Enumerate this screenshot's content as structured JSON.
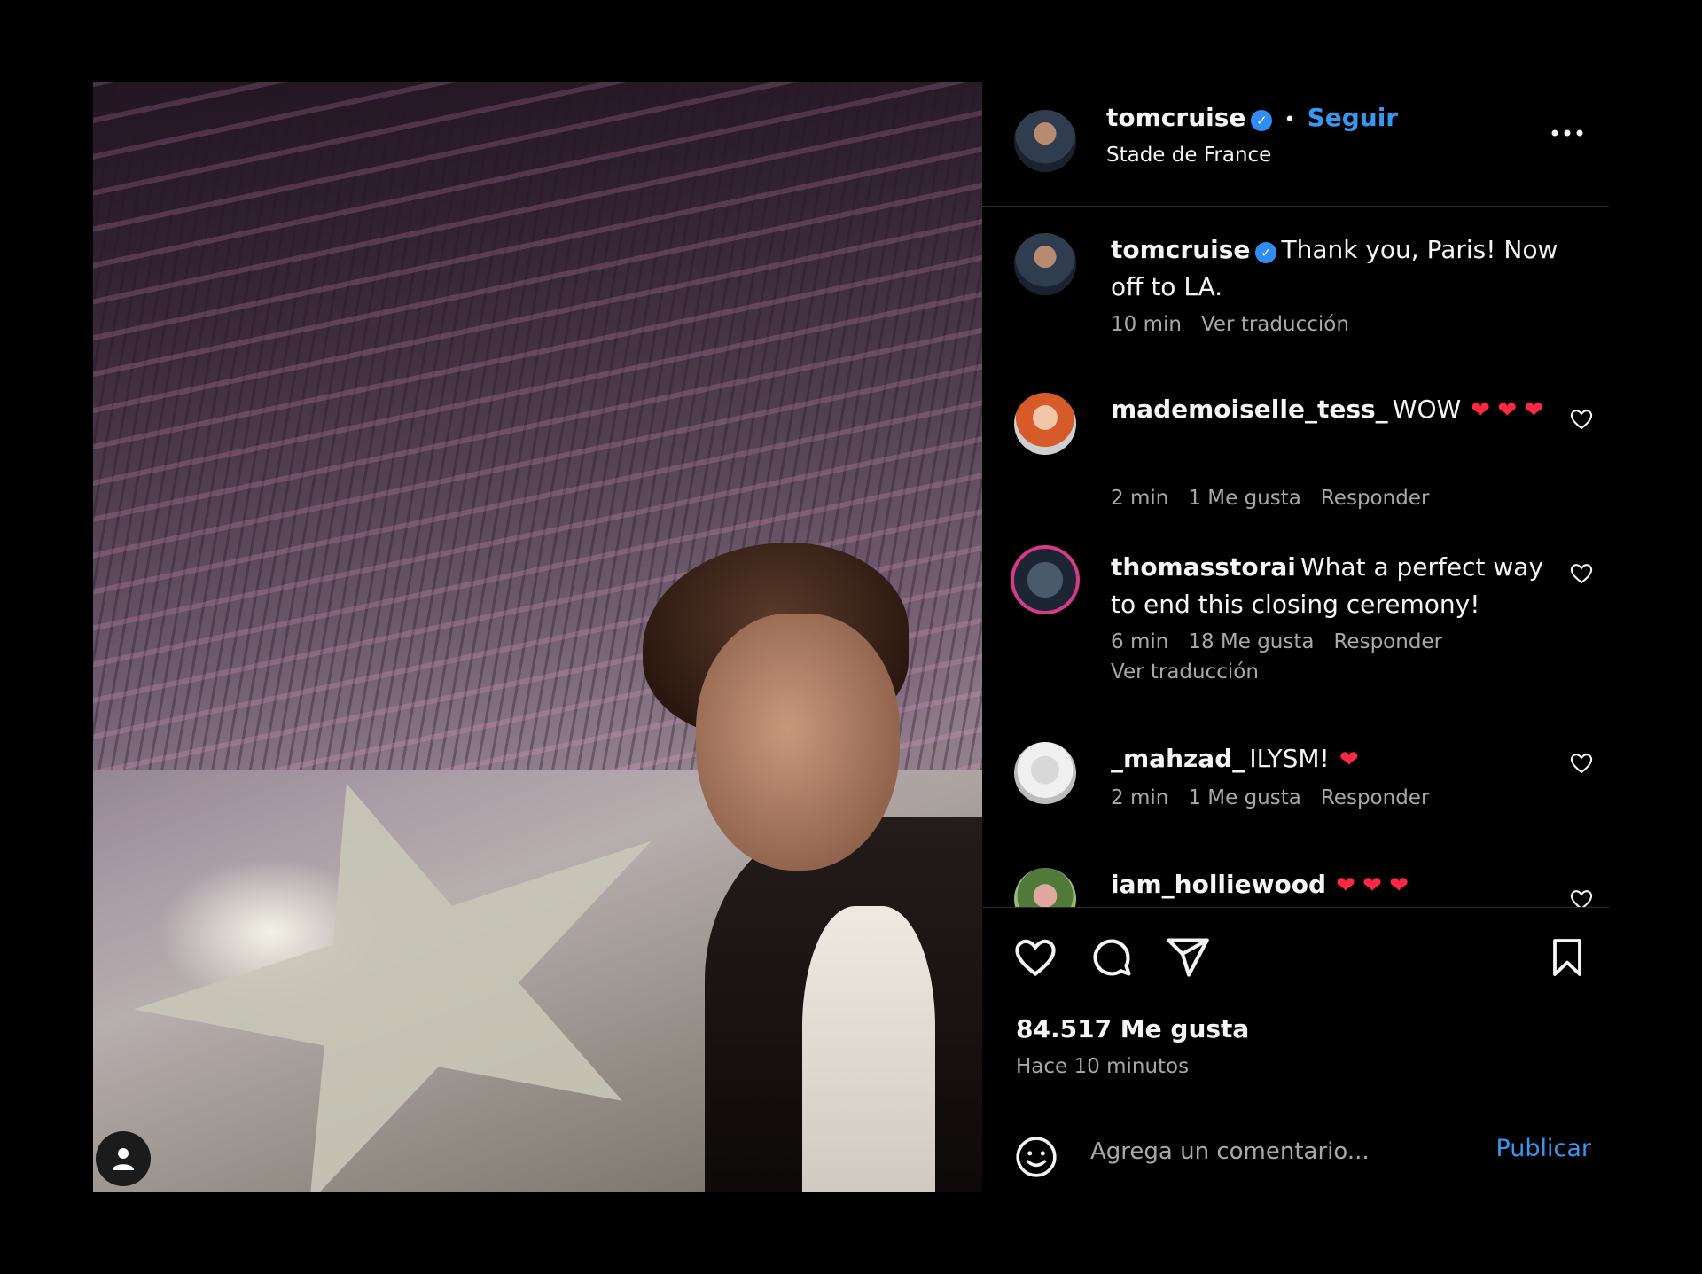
{
  "post": {
    "photo_alt": "",
    "author": "tomcruise",
    "follow_label": "Seguir",
    "separator": "•",
    "location": "Stade de France",
    "caption": "Thank you, Paris! Now off to LA.",
    "caption_time": "10 min",
    "caption_translate": "Ver traducción",
    "likes": "84.517 Me gusta",
    "time_ago": "Hace 10 minutos"
  },
  "comments": [
    {
      "user": "mademoiselle_tess_",
      "text": "WOW",
      "hearts": "❤ ❤ ❤",
      "time": "2 min",
      "likes": "1 Me gusta",
      "reply": "Responder"
    },
    {
      "user": "thomasstorai",
      "text": "What a perfect way to end this closing ceremony!",
      "time": "6 min",
      "likes": "18 Me gusta",
      "reply": "Responder",
      "translate": "Ver traducción"
    },
    {
      "user": "_mahzad_",
      "text": "ILYSM!",
      "hearts": "❤",
      "time": "2 min",
      "likes": "1 Me gusta",
      "reply": "Responder"
    },
    {
      "user": "iam_holliewood",
      "hearts": "❤ ❤ ❤"
    }
  ],
  "composer": {
    "placeholder": "Agrega un comentario...",
    "publish_label": "Publicar"
  },
  "icons": {
    "more": "more-options-icon",
    "like": "heart-icon",
    "comment": "comment-icon",
    "share": "share-icon",
    "save": "bookmark-icon",
    "emoji": "emoji-icon",
    "user_tag": "user-tag-icon"
  },
  "colors": {
    "accent": "#3897f0",
    "verified": "#2f8df5",
    "heart": "#ff2742",
    "background": "#000000"
  }
}
